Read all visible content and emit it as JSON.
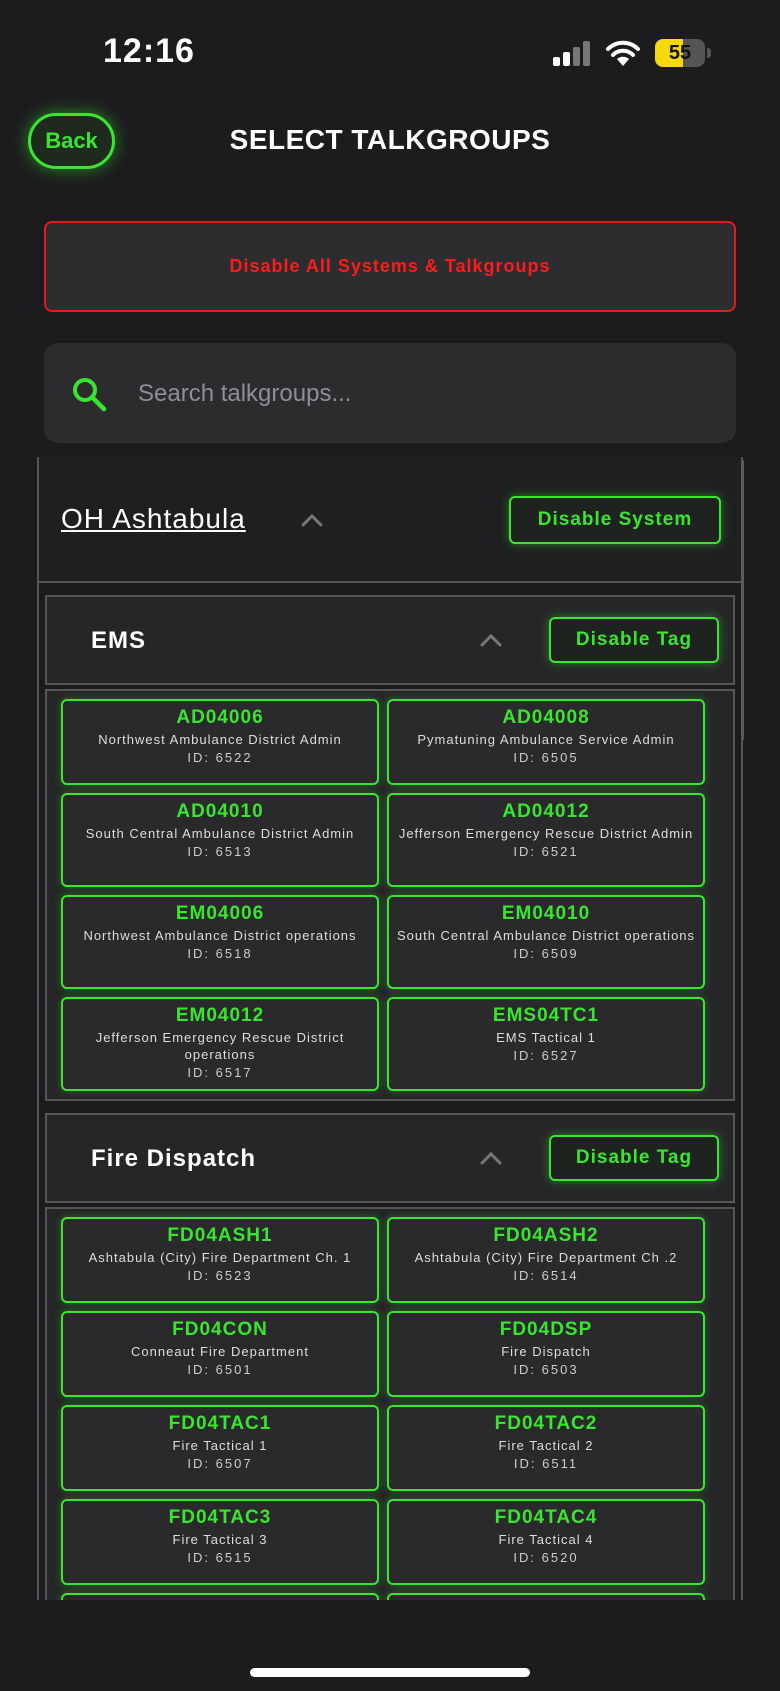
{
  "status": {
    "time": "12:16",
    "battery": "55"
  },
  "header": {
    "back": "Back",
    "title": "SELECT TALKGROUPS"
  },
  "disable_all": "Disable All Systems & Talkgroups",
  "search": {
    "placeholder": "Search talkgroups..."
  },
  "system": {
    "name": "OH Ashtabula",
    "button": "Disable System"
  },
  "tags": [
    {
      "name": "EMS",
      "button": "Disable Tag",
      "talkgroups": [
        {
          "code": "AD04006",
          "desc": "Northwest Ambulance District Admin",
          "id": "ID: 6522"
        },
        {
          "code": "AD04008",
          "desc": "Pymatuning Ambulance Service Admin",
          "id": "ID: 6505"
        },
        {
          "code": "AD04010",
          "desc": "South Central Ambulance District Admin",
          "id": "ID: 6513"
        },
        {
          "code": "AD04012",
          "desc": "Jefferson Emergency Rescue District Admin",
          "id": "ID: 6521"
        },
        {
          "code": "EM04006",
          "desc": "Northwest Ambulance District operations",
          "id": "ID: 6518"
        },
        {
          "code": "EM04010",
          "desc": "South Central Ambulance District operations",
          "id": "ID: 6509"
        },
        {
          "code": "EM04012",
          "desc": "Jefferson Emergency Rescue District operations",
          "id": "ID: 6517"
        },
        {
          "code": "EMS04TC1",
          "desc": "EMS Tactical 1",
          "id": "ID: 6527"
        }
      ]
    },
    {
      "name": "Fire Dispatch",
      "button": "Disable Tag",
      "talkgroups": [
        {
          "code": "FD04ASH1",
          "desc": "Ashtabula (City) Fire Department Ch. 1",
          "id": "ID: 6523"
        },
        {
          "code": "FD04ASH2",
          "desc": "Ashtabula (City) Fire Department Ch .2",
          "id": "ID: 6514"
        },
        {
          "code": "FD04CON",
          "desc": "Conneaut Fire Department",
          "id": "ID: 6501"
        },
        {
          "code": "FD04DSP",
          "desc": "Fire Dispatch",
          "id": "ID: 6503"
        },
        {
          "code": "FD04TAC1",
          "desc": "Fire Tactical 1",
          "id": "ID: 6507"
        },
        {
          "code": "FD04TAC2",
          "desc": "Fire Tactical 2",
          "id": "ID: 6511"
        },
        {
          "code": "FD04TAC3",
          "desc": "Fire Tactical 3",
          "id": "ID: 6515"
        },
        {
          "code": "FD04TAC4",
          "desc": "Fire Tactical 4",
          "id": "ID: 6520"
        },
        {
          "code": "",
          "desc": "",
          "id": ""
        },
        {
          "code": "",
          "desc": "",
          "id": ""
        }
      ]
    }
  ],
  "colors": {
    "accent": "#39e62f",
    "danger": "#ff1a1a",
    "background": "#1c1c1e"
  },
  "icons": [
    "search-icon",
    "chevron-up-icon",
    "cellular-signal-icon",
    "wifi-icon",
    "battery-icon"
  ]
}
